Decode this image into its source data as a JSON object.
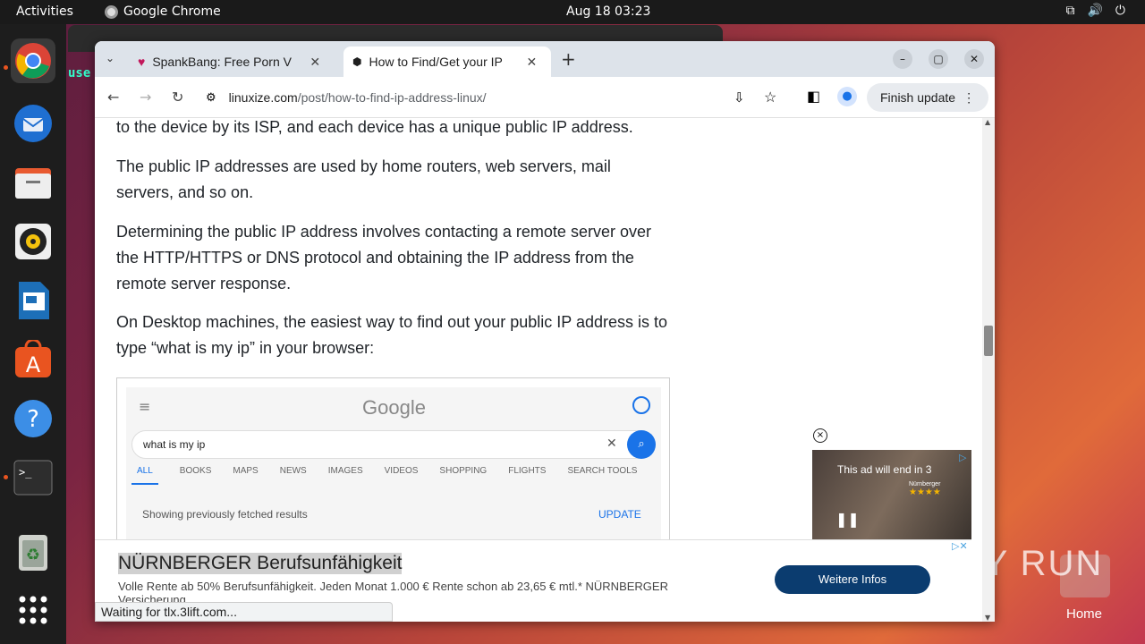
{
  "topbar": {
    "activities": "Activities",
    "app_name": "Google Chrome",
    "clock": "Aug 18  03:23"
  },
  "background_window": {
    "user_text": "use"
  },
  "browser": {
    "tabs": [
      {
        "title": "SpankBang: Free Porn V",
        "close": "✕"
      },
      {
        "title": "How to Find/Get your IP",
        "close": "✕"
      }
    ],
    "new_tab": "+",
    "url_host": "linuxize.com",
    "url_path": "/post/how-to-find-ip-address-linux/",
    "finish_update": "Finish update",
    "status": "Waiting for tlx.3lift.com..."
  },
  "article": {
    "paragraphs": [
      "to the device by its ISP, and each device has a unique public IP address.",
      "The public IP addresses are used by home routers, web servers, mail servers, and so on.",
      "Determining the public IP address involves contacting a remote server over the HTTP/HTTPS or DNS protocol and obtaining the IP address from the remote server response.",
      "On Desktop machines, the easiest way to find out your public IP address is to type “what is my ip” in your browser:"
    ]
  },
  "google_shot": {
    "logo": "Google",
    "query": "what is my ip",
    "tabs": [
      "ALL",
      "BOOKS",
      "MAPS",
      "NEWS",
      "IMAGES",
      "VIDEOS",
      "SHOPPING",
      "FLIGHTS",
      "SEARCH TOOLS"
    ],
    "fetched": "Showing previously fetched results",
    "update": "UPDATE"
  },
  "video_ad": {
    "countdown": "This ad will end in 3",
    "brand": "Nürnberger",
    "stars": "★★★★"
  },
  "banner_ad": {
    "headline": "NÜRNBERGER Berufsunfähigkeit",
    "body": "Volle Rente ab 50% Berufsunfähigkeit. Jeden Monat 1.000 € Rente schon ab 23,65 € mtl.* NÜRNBERGER Versicherung",
    "cta": "Weitere Infos"
  },
  "desktop": {
    "watermark": "ANY RUN",
    "home_label": "Home"
  }
}
